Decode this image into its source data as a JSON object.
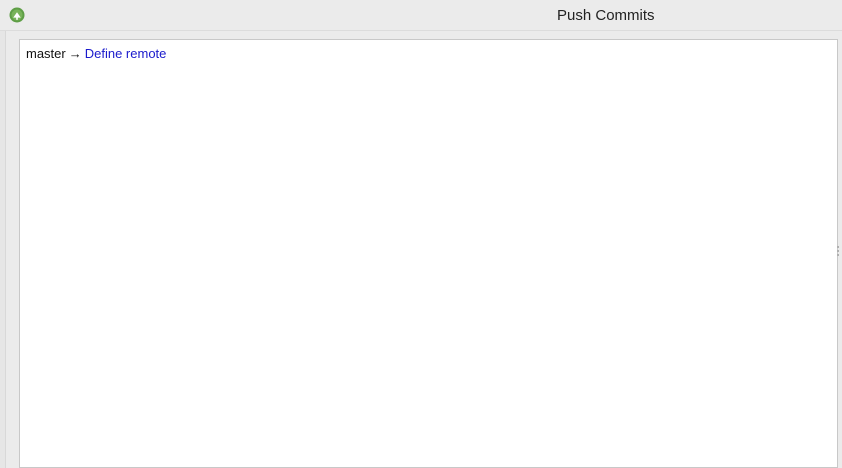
{
  "window": {
    "title": "Push Commits"
  },
  "branch": {
    "local": "master",
    "arrow": "→",
    "remote_link": "Define remote"
  }
}
